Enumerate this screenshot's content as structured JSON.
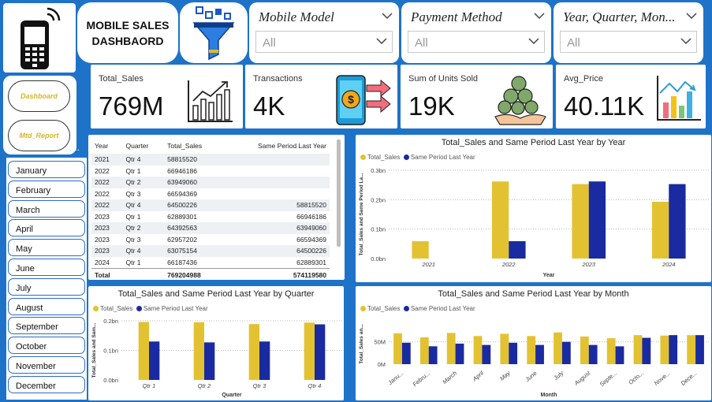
{
  "header": {
    "title": "MOBILE SALES\nDASHBAORD"
  },
  "slicers": [
    {
      "title": "Mobile Model",
      "value": "All"
    },
    {
      "title": "Payment Method",
      "value": "All"
    },
    {
      "title": "Year, Quarter, Mon...",
      "value": "All"
    }
  ],
  "nav": {
    "dashboard": "Dashboard",
    "mtd_report": "Mtd_Report",
    "more": "..."
  },
  "kpis": [
    {
      "label": "Total_Sales",
      "value": "769M",
      "icon": "bar-chart-growth-icon"
    },
    {
      "label": "Transactions",
      "value": "4K",
      "icon": "mobile-payment-icon"
    },
    {
      "label": "Sum of Units Sold",
      "value": "19K",
      "icon": "money-bags-hand-icon"
    },
    {
      "label": "Avg_Price",
      "value": "40.11K",
      "icon": "price-chart-icon"
    }
  ],
  "months": [
    "January",
    "February",
    "March",
    "April",
    "May",
    "June",
    "July",
    "August",
    "September",
    "October",
    "November",
    "December"
  ],
  "table": {
    "headers": [
      "Year",
      "Quarter",
      "Total_Sales",
      "Same Period Last Year"
    ],
    "rows": [
      [
        "2021",
        "Qtr 4",
        "58815520",
        ""
      ],
      [
        "2022",
        "Qtr 1",
        "66946186",
        ""
      ],
      [
        "2022",
        "Qtr 2",
        "63949060",
        ""
      ],
      [
        "2022",
        "Qtr 3",
        "66594369",
        ""
      ],
      [
        "2022",
        "Qtr 4",
        "64500226",
        "58815520"
      ],
      [
        "2023",
        "Qtr 1",
        "62889301",
        "66946186"
      ],
      [
        "2023",
        "Qtr 2",
        "64392563",
        "63949060"
      ],
      [
        "2023",
        "Qtr 3",
        "62957202",
        "66594369"
      ],
      [
        "2023",
        "Qtr 4",
        "63075154",
        "64500226"
      ],
      [
        "2024",
        "Qtr 1",
        "66187436",
        "62889301"
      ]
    ],
    "total": [
      "Total",
      "",
      "769204988",
      "574119580"
    ]
  },
  "colors": {
    "total_sales": "#e3c232",
    "same_period": "#1a2aa0",
    "background": "#1e73c8"
  },
  "chart_data": [
    {
      "type": "bar",
      "title": "Total_Sales and Same Period Last Year by Year",
      "xlabel": "Year",
      "ylabel": "Total_Sales and Same Period La...",
      "categories": [
        "2021",
        "2022",
        "2023",
        "2024"
      ],
      "series": [
        {
          "name": "Total_Sales",
          "values": [
            0.059,
            0.262,
            0.253,
            0.193
          ]
        },
        {
          "name": "Same Period Last Year",
          "values": [
            0,
            0.059,
            0.262,
            0.253
          ]
        }
      ],
      "ylim": [
        0,
        0.3
      ],
      "yticks": [
        "0.0bn",
        "0.1bn",
        "0.2bn",
        "0.3bn"
      ],
      "ytick_values": [
        0,
        0.1,
        0.2,
        0.3
      ],
      "legend": "top-left"
    },
    {
      "type": "bar",
      "title": "Total_Sales and Same Period Last Year by Quarter",
      "xlabel": "Quarter",
      "ylabel": "Total_Sales and Sam...",
      "categories": [
        "Qtr 1",
        "Qtr 2",
        "Qtr 3",
        "Qtr 4"
      ],
      "series": [
        {
          "name": "Total_Sales",
          "values": [
            0.196,
            0.195,
            0.189,
            0.194
          ]
        },
        {
          "name": "Same Period Last Year",
          "values": [
            0.13,
            0.127,
            0.13,
            0.188
          ]
        }
      ],
      "ylim": [
        0,
        0.2
      ],
      "yticks": [
        "0.0bn",
        "0.1bn",
        "0.2bn"
      ],
      "ytick_values": [
        0,
        0.1,
        0.2
      ],
      "legend": "top-left"
    },
    {
      "type": "bar",
      "title": "Total_Sales and Same Period Last Year by Month",
      "xlabel": "Month",
      "ylabel": "Total_Sales an...",
      "categories": [
        "Janu...",
        "Febru...",
        "March",
        "April",
        "May",
        "June",
        "July",
        "August",
        "Septe...",
        "Octo...",
        "Nove...",
        "Dece..."
      ],
      "series": [
        {
          "name": "Total_Sales",
          "values": [
            69,
            60,
            70,
            63,
            68,
            63,
            71,
            62,
            58,
            65,
            64,
            65
          ]
        },
        {
          "name": "Same Period Last Year",
          "values": [
            48,
            40,
            46,
            43,
            48,
            43,
            50,
            43,
            40,
            59,
            65,
            65
          ]
        }
      ],
      "ylim": [
        0,
        90
      ],
      "yticks": [
        "0M",
        "50M"
      ],
      "ytick_values": [
        0,
        50
      ],
      "legend": "top-left"
    }
  ]
}
